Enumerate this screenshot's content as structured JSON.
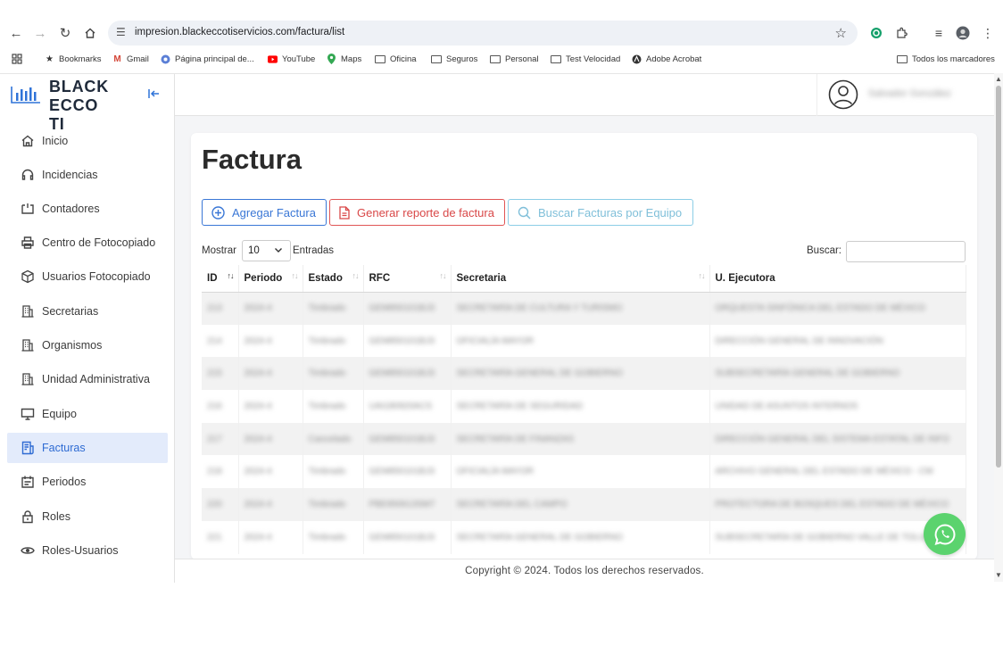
{
  "browser": {
    "url": "impresion.blackeccotiservicios.com/factura/list",
    "bookmarks": [
      {
        "label": "Bookmarks",
        "icon": "star-icon"
      },
      {
        "label": "Gmail",
        "icon": "gmail-icon"
      },
      {
        "label": "Página principal de...",
        "icon": "globe-icon"
      },
      {
        "label": "YouTube",
        "icon": "youtube-icon"
      },
      {
        "label": "Maps",
        "icon": "maps-pin-icon"
      },
      {
        "label": "Oficina",
        "icon": "folder-icon"
      },
      {
        "label": "Seguros",
        "icon": "folder-icon"
      },
      {
        "label": "Personal",
        "icon": "folder-icon"
      },
      {
        "label": "Test Velocidad",
        "icon": "folder-icon"
      },
      {
        "label": "Adobe Acrobat",
        "icon": "acrobat-icon"
      }
    ],
    "all_bookmarks": "Todos los marcadores"
  },
  "brand": {
    "line1": "BLACK ECCO",
    "line2": "TI"
  },
  "sidebar": {
    "items": [
      {
        "label": "Inicio",
        "icon": "home-icon"
      },
      {
        "label": "Incidencias",
        "icon": "headset-icon"
      },
      {
        "label": "Contadores",
        "icon": "counter-icon"
      },
      {
        "label": "Centro de Fotocopiado",
        "icon": "printer-icon"
      },
      {
        "label": "Usuarios Fotocopiado",
        "icon": "box-icon"
      },
      {
        "label": "Secretarias",
        "icon": "building-icon"
      },
      {
        "label": "Organismos",
        "icon": "building-icon"
      },
      {
        "label": "Unidad Administrativa",
        "icon": "building-icon"
      },
      {
        "label": "Equipo",
        "icon": "monitor-icon"
      },
      {
        "label": "Facturas",
        "icon": "invoice-icon",
        "active": true
      },
      {
        "label": "Periodos",
        "icon": "calendar-icon"
      },
      {
        "label": "Roles",
        "icon": "lock-icon"
      },
      {
        "label": "Roles-Usuarios",
        "icon": "eye-icon"
      }
    ]
  },
  "user": {
    "name": "Salvador González"
  },
  "page": {
    "title": "Factura",
    "buttons": {
      "add": "Agregar Factura",
      "report": "Generar reporte de factura",
      "search_by_equipment": "Buscar Facturas por Equipo"
    },
    "show_label": "Mostrar",
    "page_size": "10",
    "entries_label": "Entradas",
    "search_label": "Buscar:"
  },
  "table": {
    "columns": [
      "ID",
      "Periodo",
      "Estado",
      "RFC",
      "Secretaria",
      "U. Ejecutora"
    ],
    "rows": [
      [
        "213",
        "2024-4",
        "Timbrado",
        "GEM850101BJ3",
        "SECRETARÍA DE CULTURA Y TURISMO",
        "ORQUESTA SINFÓNICA DEL ESTADO DE MÉXICO"
      ],
      [
        "214",
        "2024-4",
        "Timbrado",
        "GEM850101BJ3",
        "OFICIALÍA MAYOR",
        "DIRECCIÓN GENERAL DE INNOVACIÓN"
      ],
      [
        "215",
        "2024-4",
        "Timbrado",
        "GEM850101BJ3",
        "SECRETARÍA GENERAL DE GOBIERNO",
        "SUBSECRETARÍA GENERAL DE GOBIERNO"
      ],
      [
        "216",
        "2024-4",
        "Timbrado",
        "UAI180920ACS",
        "SECRETARÍA DE SEGURIDAD",
        "UNIDAD DE ASUNTOS INTERNOS"
      ],
      [
        "217",
        "2024-4",
        "Cancelado",
        "GEM850101BJ3",
        "SECRETARÍA DE FINANZAS",
        "DIRECCIÓN GENERAL DEL SISTEMA ESTATAL DE INFO"
      ],
      [
        "218",
        "2024-4",
        "Timbrado",
        "GEM850101BJ3",
        "OFICIALÍA MAYOR",
        "ARCHIVO GENERAL DEL ESTADO DE MÉXICO - CM"
      ],
      [
        "220",
        "2024-4",
        "Timbrado",
        "PBE950613SM7",
        "SECRETARÍA DEL CAMPO",
        "PROTECTORA DE BOSQUES DEL ESTADO DE MÉXICO"
      ],
      [
        "221",
        "2024-4",
        "Timbrado",
        "GEM850101BJ3",
        "SECRETARÍA GENERAL DE GOBIERNO",
        "SUBSECRETARÍA DE GOBIERNO VALLE DE TOLUCA"
      ]
    ]
  },
  "footer": {
    "text": "Copyright © 2024. Todos los derechos reservados."
  },
  "colors": {
    "primary": "#2e6bd3",
    "danger": "#d94848",
    "info": "#7fbfd9",
    "whatsapp": "#5bd36e"
  }
}
